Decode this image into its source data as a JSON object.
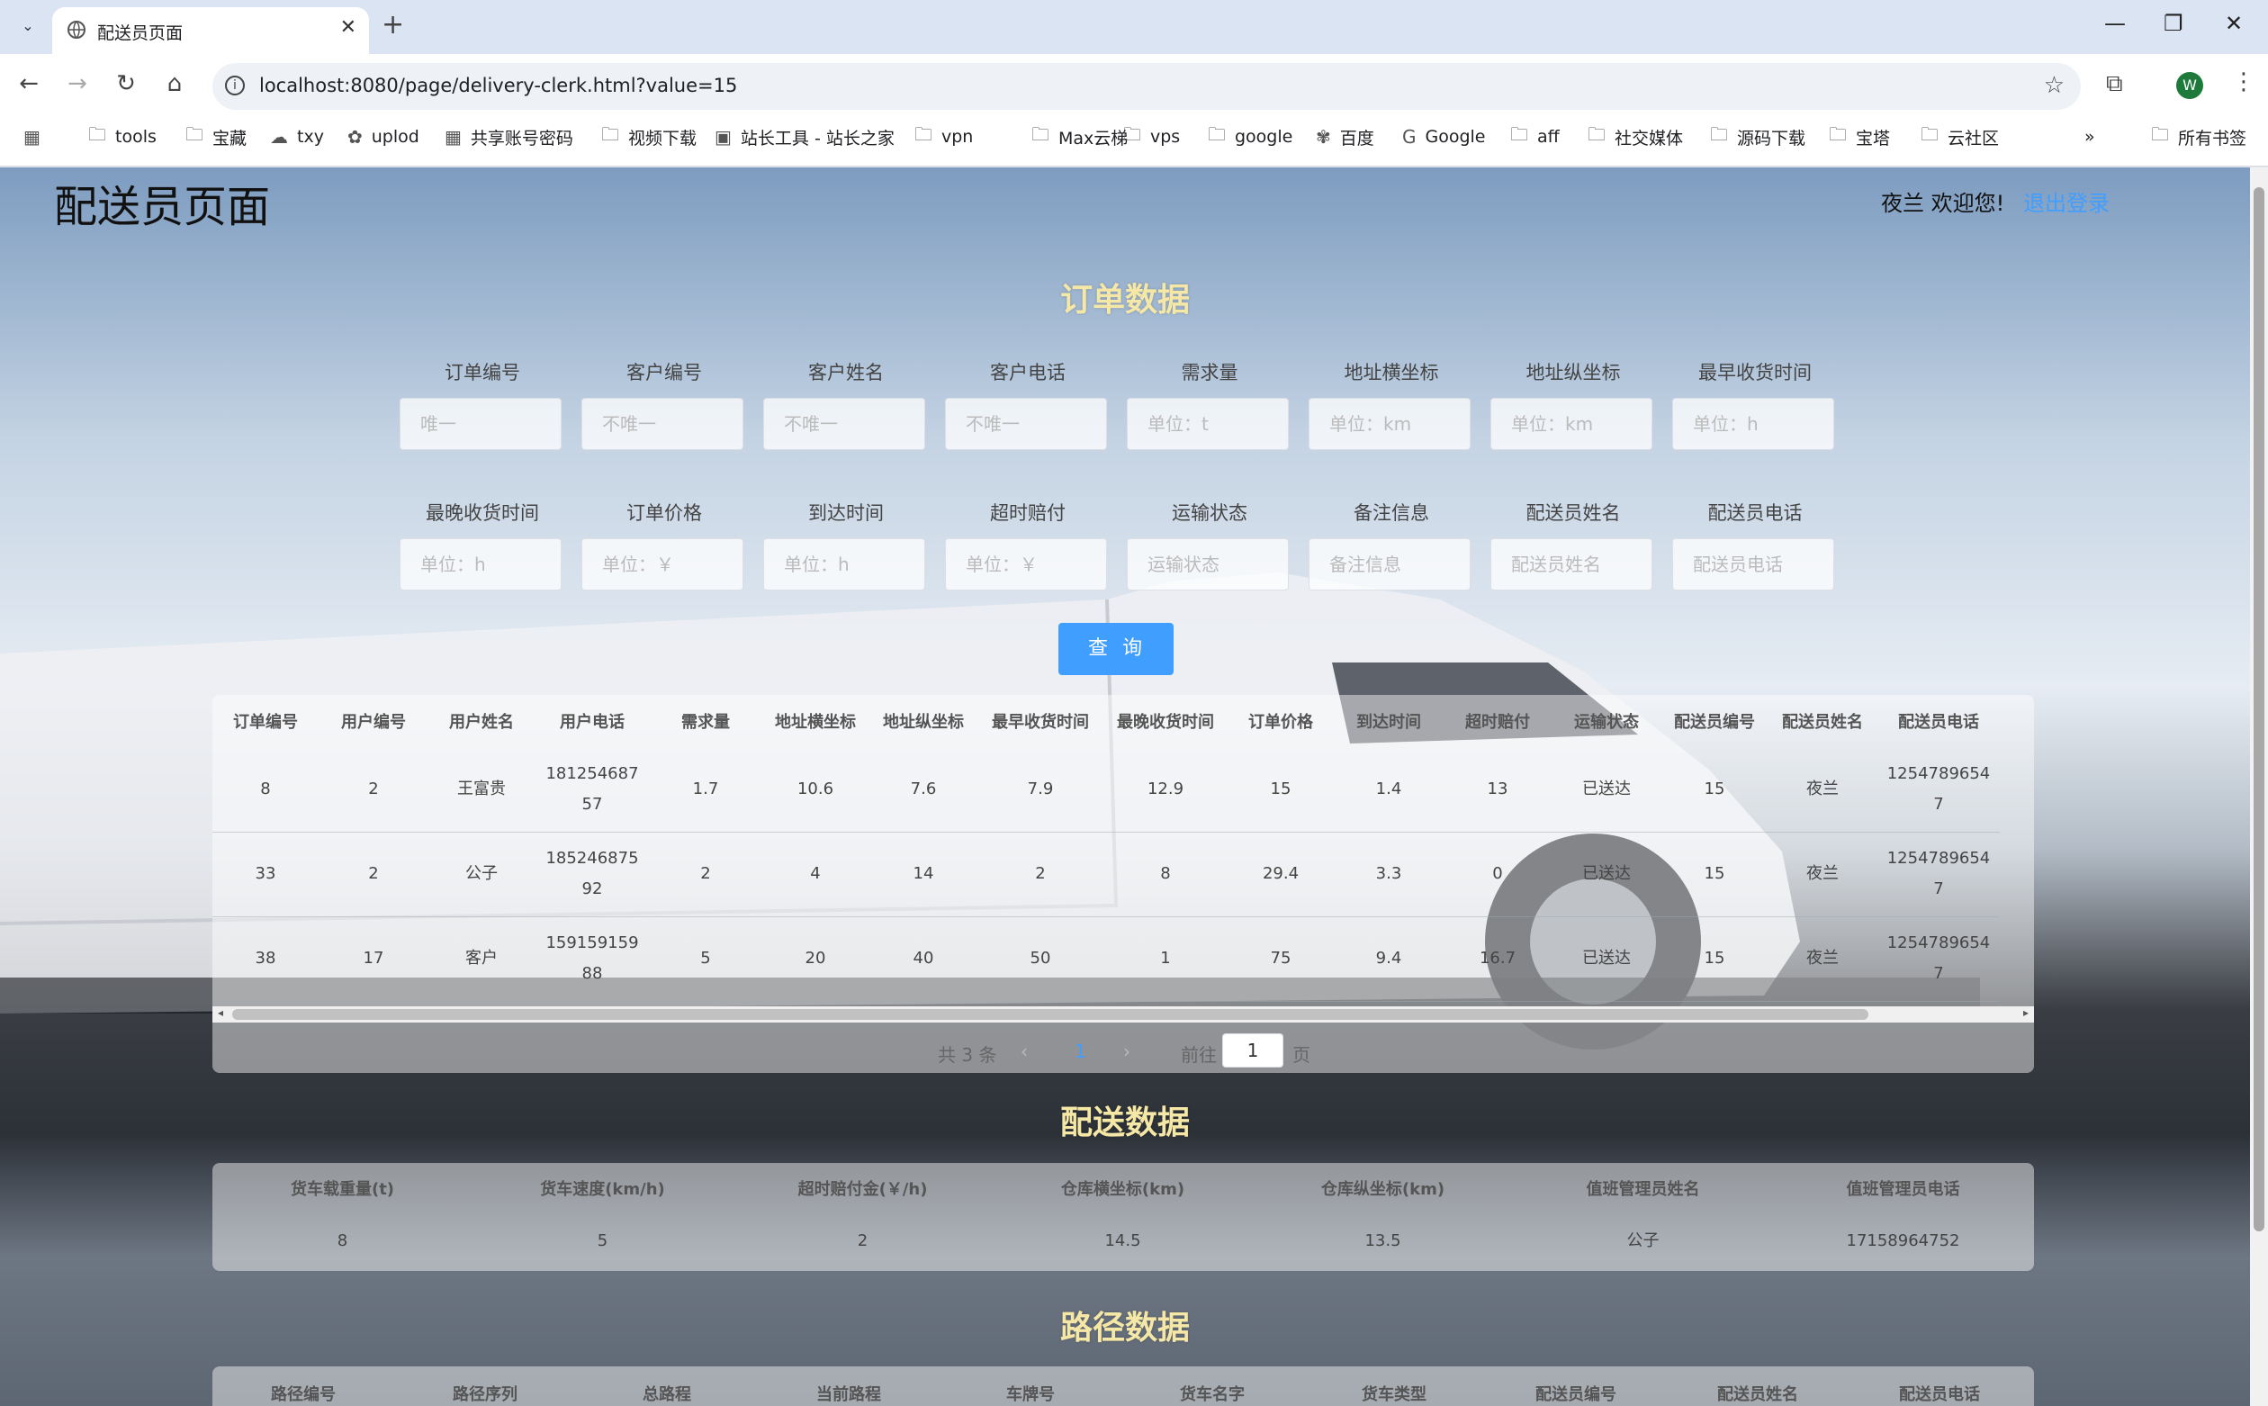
{
  "browser": {
    "tab_title": "配送员页面",
    "url": "localhost:8080/page/delivery-clerk.html?value=15",
    "avatar_letter": "W",
    "bookmarks": [
      "tools",
      "宝藏",
      "txy",
      "uplod",
      "共享账号密码",
      "视频下载",
      "站长工具 - 站长之家",
      "vpn",
      "Max云梯",
      "vps",
      "google",
      "百度",
      "Google",
      "aff",
      "社交媒体",
      "源码下载",
      "宝塔",
      "云社区"
    ],
    "bookmarks_more": "»",
    "all_bookmarks": "所有书签"
  },
  "header": {
    "title": "配送员页面",
    "welcome": "夜兰 欢迎您!",
    "logout": "退出登录"
  },
  "order_section": {
    "heading": "订单数据",
    "fields_row1": [
      {
        "label": "订单编号",
        "placeholder": "唯一"
      },
      {
        "label": "客户编号",
        "placeholder": "不唯一"
      },
      {
        "label": "客户姓名",
        "placeholder": "不唯一"
      },
      {
        "label": "客户电话",
        "placeholder": "不唯一"
      },
      {
        "label": "需求量",
        "placeholder": "单位：t"
      },
      {
        "label": "地址横坐标",
        "placeholder": "单位：km"
      },
      {
        "label": "地址纵坐标",
        "placeholder": "单位：km"
      },
      {
        "label": "最早收货时间",
        "placeholder": "单位：h"
      }
    ],
    "fields_row2": [
      {
        "label": "最晚收货时间",
        "placeholder": "单位：h"
      },
      {
        "label": "订单价格",
        "placeholder": "单位：￥"
      },
      {
        "label": "到达时间",
        "placeholder": "单位：h"
      },
      {
        "label": "超时赔付",
        "placeholder": "单位：￥"
      },
      {
        "label": "运输状态",
        "placeholder": "运输状态"
      },
      {
        "label": "备注信息",
        "placeholder": "备注信息"
      },
      {
        "label": "配送员姓名",
        "placeholder": "配送员姓名"
      },
      {
        "label": "配送员电话",
        "placeholder": "配送员电话"
      }
    ],
    "query_label": "查询",
    "table_headers": [
      "订单编号",
      "用户编号",
      "用户姓名",
      "用户电话",
      "需求量",
      "地址横坐标",
      "地址纵坐标",
      "最早收货时间",
      "最晚收货时间",
      "订单价格",
      "到达时间",
      "超时赔付",
      "运输状态",
      "配送员编号",
      "配送员姓名",
      "配送员电话"
    ],
    "rows": [
      [
        "8",
        "2",
        "王富贵",
        "18125468757",
        "1.7",
        "10.6",
        "7.6",
        "7.9",
        "12.9",
        "15",
        "1.4",
        "13",
        "已送达",
        "15",
        "夜兰",
        "12547896547"
      ],
      [
        "33",
        "2",
        "公子",
        "18524687592",
        "2",
        "4",
        "14",
        "2",
        "8",
        "29.4",
        "3.3",
        "0",
        "已送达",
        "15",
        "夜兰",
        "12547896547"
      ],
      [
        "38",
        "17",
        "客户",
        "15915915988",
        "5",
        "20",
        "40",
        "50",
        "1",
        "75",
        "9.4",
        "16.7",
        "已送达",
        "15",
        "夜兰",
        "12547896547"
      ]
    ],
    "pager": {
      "total": "共 3 条",
      "current": "1",
      "goto": "前往",
      "page_input": "1",
      "page_suffix": "页"
    }
  },
  "delivery_section": {
    "heading": "配送数据",
    "headers": [
      "货车载重量(t)",
      "货车速度(km/h)",
      "超时赔付金(￥/h)",
      "仓库横坐标(km)",
      "仓库纵坐标(km)",
      "值班管理员姓名",
      "值班管理员电话"
    ],
    "row": [
      "8",
      "5",
      "2",
      "14.5",
      "13.5",
      "公子",
      "17158964752"
    ]
  },
  "route_section": {
    "heading": "路径数据",
    "headers": [
      "路径编号",
      "路径序列",
      "总路程",
      "当前路程",
      "车牌号",
      "货车名字",
      "货车类型",
      "配送员编号",
      "配送员姓名",
      "配送员电话"
    ]
  }
}
